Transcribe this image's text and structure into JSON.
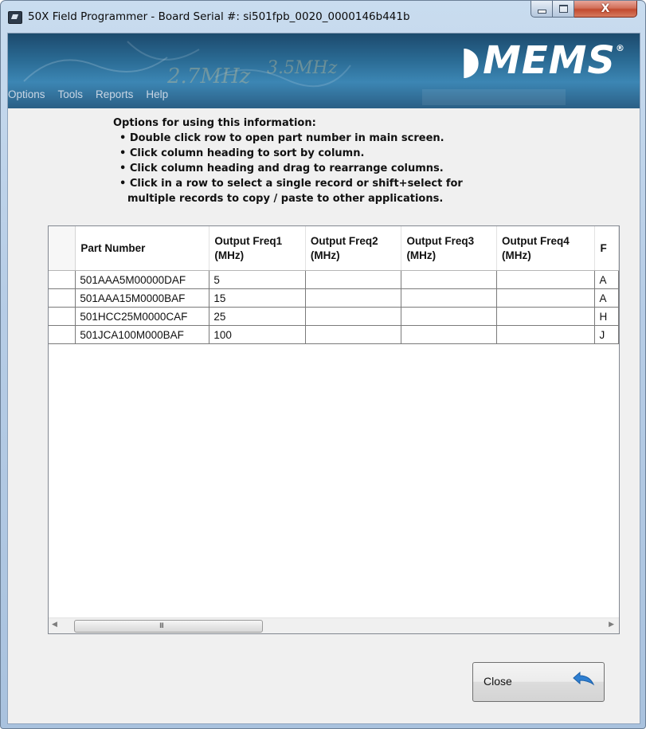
{
  "window": {
    "title": "50X Field Programmer - Board Serial #: si501fpb_0020_0000146b441b",
    "controls": {
      "minimize": "minimize",
      "maximize": "maximize",
      "close": "X"
    }
  },
  "banner": {
    "logo_text": "MEMS",
    "logo_mark": "®",
    "scribble_text_1": "3.5MHz",
    "scribble_text_2": "2.7MHz"
  },
  "menu": {
    "items": [
      {
        "label": "Options"
      },
      {
        "label": "Tools"
      },
      {
        "label": "Reports"
      },
      {
        "label": "Help"
      }
    ]
  },
  "instructions": {
    "title": "Options for using this information:",
    "bullets": [
      "• Double click row to open part number in main screen.",
      "• Click column heading to sort by column.",
      "• Click column heading and drag to rearrange columns.",
      "• Click in a row to select a single record or shift+select for"
    ],
    "continuation": "multiple records to copy / paste to other applications."
  },
  "grid": {
    "columns": [
      {
        "label": "Part Number"
      },
      {
        "label": "Output Freq1 (MHz)"
      },
      {
        "label": "Output Freq2 (MHz)"
      },
      {
        "label": "Output Freq3 (MHz)"
      },
      {
        "label": "Output Freq4 (MHz)"
      },
      {
        "label": "F"
      }
    ],
    "rows": [
      {
        "part": "501AAA5M00000DAF",
        "f1": "5",
        "f2": "",
        "f3": "",
        "f4": "",
        "f5": "A"
      },
      {
        "part": "501AAA15M0000BAF",
        "f1": "15",
        "f2": "",
        "f3": "",
        "f4": "",
        "f5": "A"
      },
      {
        "part": "501HCC25M0000CAF",
        "f1": "25",
        "f2": "",
        "f3": "",
        "f4": "",
        "f5": "H"
      },
      {
        "part": "501JCA100M000BAF",
        "f1": "100",
        "f2": "",
        "f3": "",
        "f4": "",
        "f5": "J"
      }
    ],
    "scroll_grip": "III"
  },
  "buttons": {
    "close_label": "Close"
  },
  "colors": {
    "banner": "#2a6a93",
    "content_bg": "#f0f0f0",
    "back_arrow": "#2f7fd1"
  },
  "icons": {
    "app": "app-icon",
    "back": "back-arrow-icon",
    "scroll_left": "scroll-left-arrow-icon",
    "scroll_right": "scroll-right-arrow-icon"
  }
}
